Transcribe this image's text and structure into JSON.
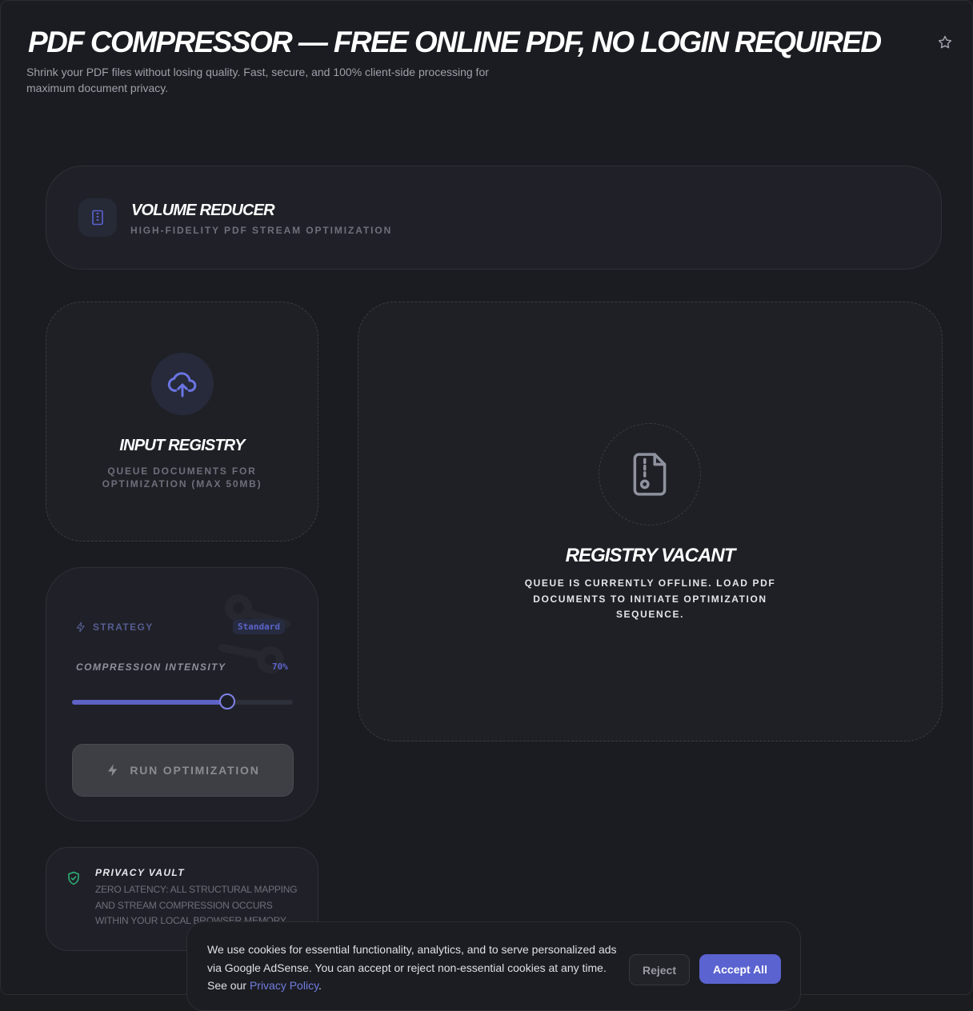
{
  "page": {
    "title": "PDF COMPRESSOR — FREE ONLINE PDF, NO LOGIN REQUIRED",
    "subtitle": "Shrink your PDF files without losing quality. Fast, secure, and 100% client-side processing for maximum document privacy."
  },
  "module": {
    "title": "VOLUME REDUCER",
    "subtitle": "HIGH-FIDELITY PDF STREAM OPTIMIZATION",
    "icon": "archive-icon"
  },
  "input_registry": {
    "title": "INPUT REGISTRY",
    "subtitle": "QUEUE DOCUMENTS FOR OPTIMIZATION (MAX 50MB)",
    "icon": "cloud-upload-icon"
  },
  "settings": {
    "strategy_label": "STRATEGY",
    "strategy_value": "Standard",
    "intensity_label": "COMPRESSION INTENSITY",
    "intensity_value": "70%",
    "intensity_percent": 70,
    "run_label": "RUN OPTIMIZATION"
  },
  "privacy": {
    "title": "PRIVACY VAULT",
    "text": "ZERO LATENCY: ALL STRUCTURAL MAPPING AND STREAM COMPRESSION OCCURS WITHIN YOUR LOCAL BROWSER MEMORY."
  },
  "queue": {
    "title": "REGISTRY VACANT",
    "text": "QUEUE IS CURRENTLY OFFLINE. LOAD PDF DOCUMENTS TO INITIATE OPTIMIZATION SEQUENCE.",
    "icon": "file-archive-icon"
  },
  "cookie": {
    "text": "We use cookies for essential functionality, analytics, and to serve personalized ads via Google AdSense. You can accept or reject non-essential cookies at any time. See our ",
    "link_label": "Privacy Policy",
    "period": ".",
    "reject_label": "Reject",
    "accept_label": "Accept All"
  },
  "colors": {
    "background": "#1b1c21",
    "card": "#202128",
    "accent": "#5a63cf",
    "privacy_green": "#2fb67a"
  }
}
